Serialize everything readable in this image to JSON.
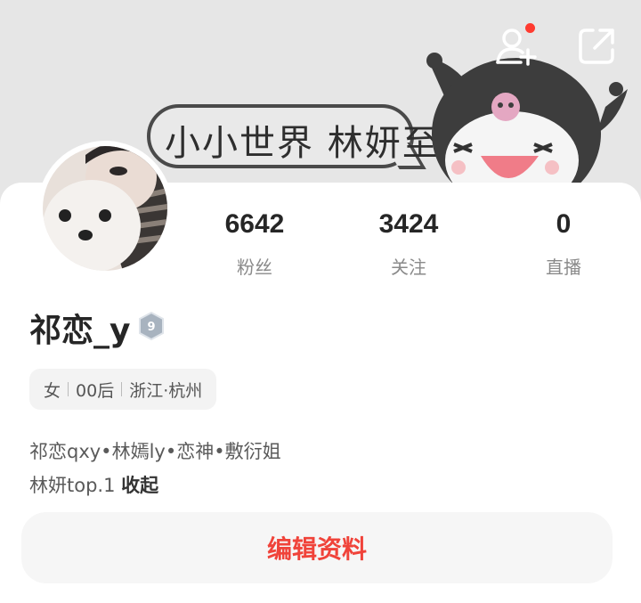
{
  "cover": {
    "bubble_text": "小小世界 林妍至上"
  },
  "header": {
    "add_friend_icon": "add-user-icon",
    "share_icon": "share-icon",
    "notification_color": "#ff3b30"
  },
  "stats": [
    {
      "value": "6642",
      "label": "粉丝"
    },
    {
      "value": "3424",
      "label": "关注"
    },
    {
      "value": "0",
      "label": "直播"
    }
  ],
  "profile": {
    "username": "祁恋_y",
    "level": "9",
    "tags": [
      "女",
      "00后",
      "浙江·杭州"
    ],
    "bio_line1": "祁恋qxy•林嫣ly•恋神•敷衍姐",
    "bio_line2": "林妍top.1",
    "collapse_label": "收起"
  },
  "edit_button": {
    "label": "编辑资料",
    "color": "#f0433a"
  }
}
